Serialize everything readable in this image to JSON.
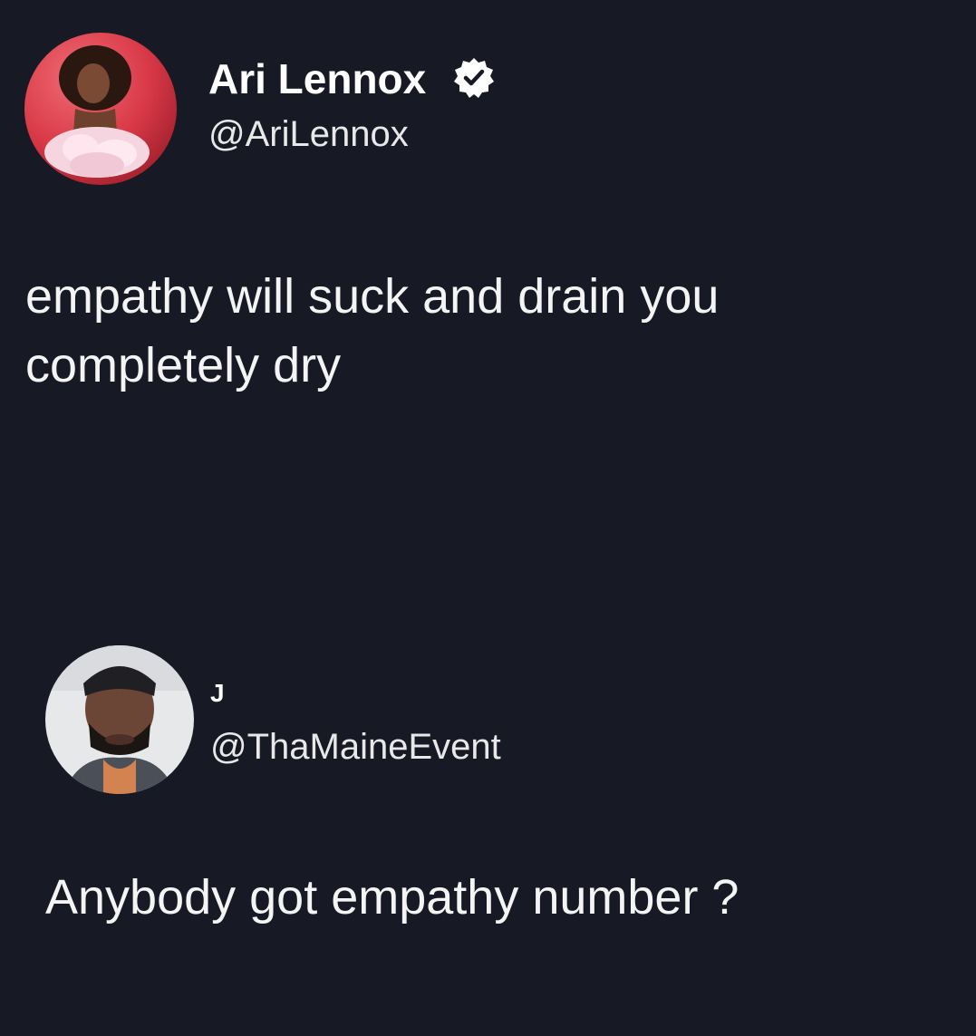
{
  "colors": {
    "background": "#171a24",
    "text": "#f4f4f4",
    "verified_badge": "#ffffff"
  },
  "icons": {
    "verified": "verified-badge-icon"
  },
  "tweet": {
    "display_name": "Ari Lennox",
    "handle": "@AriLennox",
    "text": "empathy will suck and drain you completely dry"
  },
  "reply": {
    "display_name": "J",
    "handle": "@ThaMaineEvent",
    "text": "Anybody got empathy number ?"
  }
}
